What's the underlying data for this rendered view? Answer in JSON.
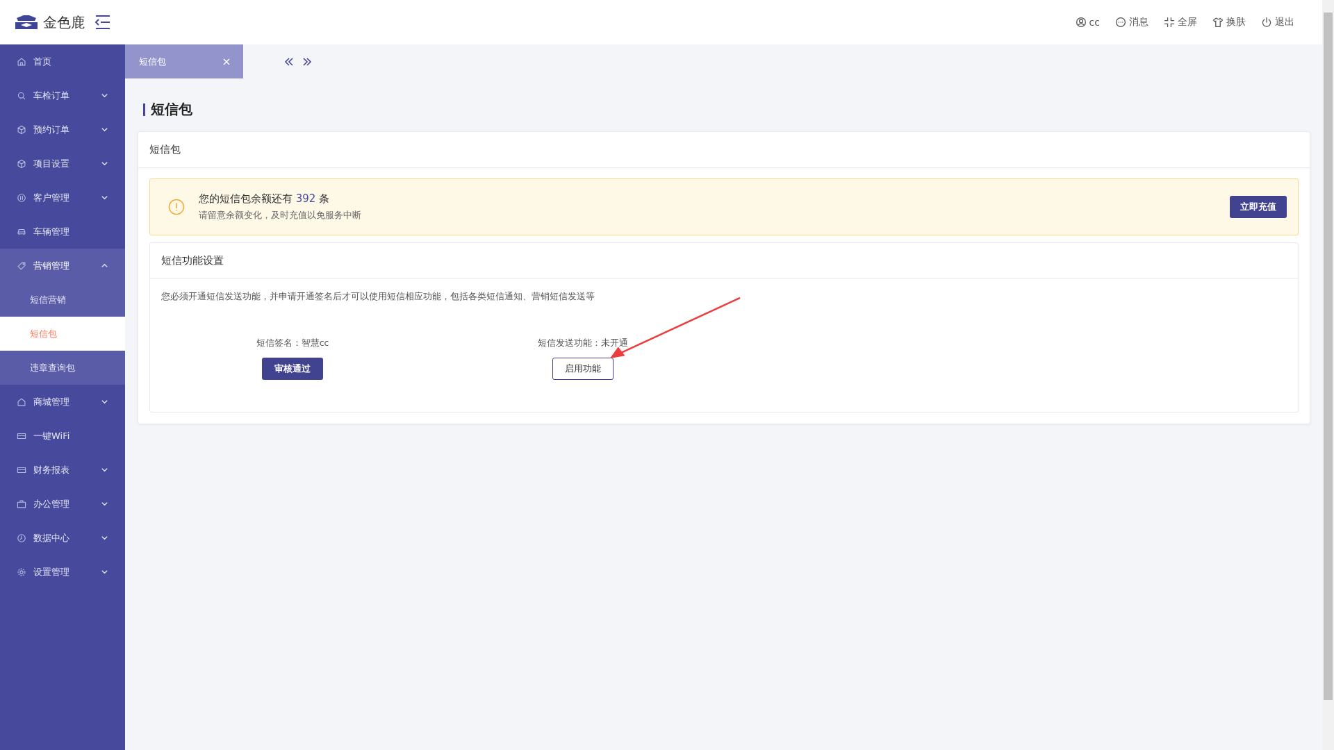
{
  "header": {
    "brand": "金色鹿",
    "actions": [
      {
        "label": "cc"
      },
      {
        "label": "消息"
      },
      {
        "label": "全屏"
      },
      {
        "label": "换肤"
      },
      {
        "label": "退出"
      }
    ]
  },
  "sidebar": {
    "items": [
      {
        "label": "首页",
        "has_submenu": false,
        "expanded": false
      },
      {
        "label": "车检订单",
        "has_submenu": true,
        "expanded": false
      },
      {
        "label": "预约订单",
        "has_submenu": true,
        "expanded": false
      },
      {
        "label": "项目设置",
        "has_submenu": true,
        "expanded": false
      },
      {
        "label": "客户管理",
        "has_submenu": true,
        "expanded": false
      },
      {
        "label": "车辆管理",
        "has_submenu": false,
        "expanded": false
      },
      {
        "label": "营销管理",
        "has_submenu": true,
        "expanded": true,
        "children": [
          {
            "label": "短信营销",
            "selected": false
          },
          {
            "label": "短信包",
            "selected": true
          },
          {
            "label": "违章查询包",
            "selected": false
          }
        ]
      },
      {
        "label": "商城管理",
        "has_submenu": true,
        "expanded": false
      },
      {
        "label": "一键WiFi",
        "has_submenu": false,
        "expanded": false
      },
      {
        "label": "财务报表",
        "has_submenu": true,
        "expanded": false
      },
      {
        "label": "办公管理",
        "has_submenu": true,
        "expanded": false
      },
      {
        "label": "数据中心",
        "has_submenu": true,
        "expanded": false
      },
      {
        "label": "设置管理",
        "has_submenu": true,
        "expanded": false
      }
    ]
  },
  "tabs": [
    {
      "label": "短信包",
      "selected": true
    }
  ],
  "page_title": "短信包",
  "card": {
    "title": "短信包",
    "alert": {
      "prefix": "您的短信包余额还有",
      "count": "392",
      "suffix": "条",
      "note": "请留意余额变化，及时充值以免服务中断",
      "button": "立即充值"
    },
    "settings": {
      "title": "短信功能设置",
      "description": "您必须开通短信发送功能，并申请开通签名后才可以使用短信相应功能，包括各类短信通知、营销短信发送等",
      "items": [
        {
          "label": "短信签名：智慧cc",
          "button": "审核通过",
          "kind": "primary"
        },
        {
          "label": "短信发送功能：未开通",
          "button": "启用功能",
          "kind": "outline"
        }
      ]
    }
  }
}
